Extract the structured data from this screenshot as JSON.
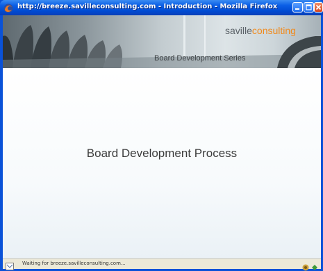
{
  "window": {
    "title": "http://breeze.savilleconsulting.com - Introduction - Mozilla Firefox"
  },
  "banner": {
    "brand_prefix": "saville",
    "brand_suffix": "consulting",
    "series_title": "Board Development Series",
    "brand_accent_color": "#f08a1c"
  },
  "slide": {
    "title": "Board Development Process"
  },
  "statusbar": {
    "text": "Waiting for breeze.savilleconsulting.com..."
  },
  "icons": {
    "app": "firefox-icon",
    "minimize": "minimize-icon",
    "maximize": "maximize-icon",
    "close": "close-icon",
    "status": "page-loading-icon",
    "tray": [
      "security-icon",
      "connection-icon"
    ]
  }
}
